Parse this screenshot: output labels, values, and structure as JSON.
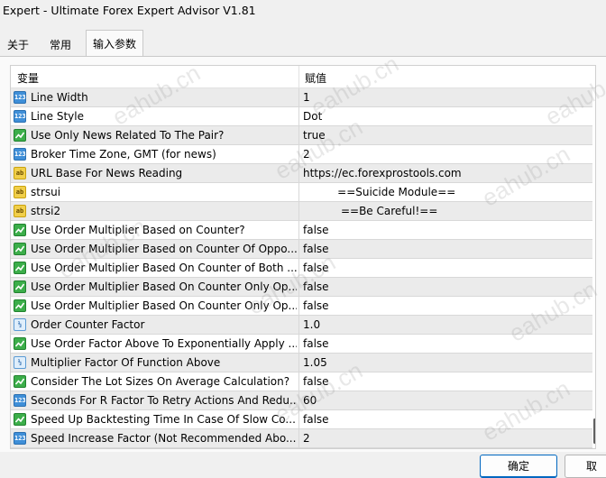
{
  "window": {
    "title": "Expert - Ultimate Forex Expert Advisor V1.81"
  },
  "tabs": [
    {
      "label": "关于"
    },
    {
      "label": "常用"
    },
    {
      "label": "输入参数"
    }
  ],
  "table": {
    "headers": {
      "variable": "变量",
      "value": "赋值"
    },
    "rows": [
      {
        "type": "int",
        "icon_text": "123",
        "name": "Line Width",
        "value": "1"
      },
      {
        "type": "int",
        "icon_text": "123",
        "name": "Line Style",
        "value": "Dot"
      },
      {
        "type": "bool",
        "icon_text": "",
        "name": "Use Only News Related To The Pair?",
        "value": "true"
      },
      {
        "type": "int",
        "icon_text": "123",
        "name": "Broker Time Zone, GMT (for news)",
        "value": "2"
      },
      {
        "type": "str",
        "icon_text": "ab",
        "name": "URL Base For News Reading",
        "value": "https://ec.forexprostools.com"
      },
      {
        "type": "str",
        "icon_text": "ab",
        "name": "strsui",
        "value": "          ==Suicide Module=="
      },
      {
        "type": "str",
        "icon_text": "ab",
        "name": "strsi2",
        "value": "           ==Be Careful!=="
      },
      {
        "type": "bool",
        "icon_text": "",
        "name": "Use Order Multiplier Based on Counter?",
        "value": "false"
      },
      {
        "type": "bool",
        "icon_text": "",
        "name": "Use Order Multiplier Based on Counter Of Oppo...",
        "value": "false"
      },
      {
        "type": "bool",
        "icon_text": "",
        "name": "Use Order Multiplier Based On Counter of Both ...",
        "value": "false"
      },
      {
        "type": "bool",
        "icon_text": "",
        "name": "Use Order Multiplier Based On Counter Only Op...",
        "value": "false"
      },
      {
        "type": "bool",
        "icon_text": "",
        "name": "Use Order Multiplier Based On Counter Only Op...",
        "value": "false"
      },
      {
        "type": "dbl",
        "icon_text": "½",
        "name": "Order Counter Factor",
        "value": "1.0"
      },
      {
        "type": "bool",
        "icon_text": "",
        "name": "Use Order Factor Above To Exponentially Apply ...",
        "value": "false"
      },
      {
        "type": "dbl",
        "icon_text": "½",
        "name": "Multiplier Factor Of Function Above",
        "value": "1.05"
      },
      {
        "type": "bool",
        "icon_text": "",
        "name": "Consider The Lot Sizes On Average Calculation?",
        "value": "false"
      },
      {
        "type": "int",
        "icon_text": "123",
        "name": "Seconds For R Factor To Retry Actions And Redu...",
        "value": "60"
      },
      {
        "type": "bool",
        "icon_text": "",
        "name": "Speed Up Backtesting Time In Case Of Slow Co...",
        "value": "false"
      },
      {
        "type": "int",
        "icon_text": "123",
        "name": "Speed Increase Factor (Not Recommended Abo...",
        "value": "2"
      }
    ]
  },
  "buttons": {
    "ok": "确定",
    "cancel": "取"
  },
  "watermark": "eahub.cn",
  "colors": {
    "ok_border": "#0067c0",
    "alt_row": "#ebebeb"
  }
}
